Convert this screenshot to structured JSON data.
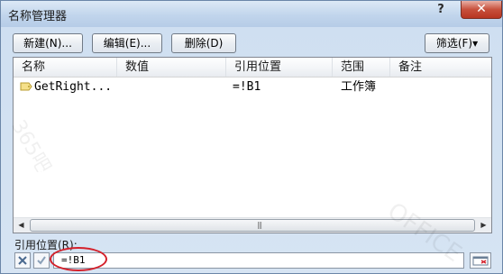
{
  "window": {
    "title": "名称管理器",
    "help_label": "?",
    "close_label": "✕"
  },
  "toolbar": {
    "new_label": "新建(N)...",
    "edit_label": "编辑(E)...",
    "delete_label": "删除(D)",
    "filter_label": "筛选(F)▾"
  },
  "table": {
    "columns": [
      "名称",
      "数值",
      "引用位置",
      "范围",
      "备注"
    ],
    "rows": [
      {
        "name": "GetRight...",
        "value": "",
        "refers_to": "=!B1",
        "scope": "工作簿",
        "comment": ""
      }
    ]
  },
  "footer": {
    "label": "引用位置(R):",
    "value": "=!B1"
  },
  "colors": {
    "annotation_circle": "#d4202a",
    "title_bar": "#c1d5ec",
    "close_button": "#c7503c"
  },
  "icons": [
    "name-tag-icon",
    "cancel-x-icon",
    "confirm-check-icon",
    "collapse-dialog-icon"
  ]
}
